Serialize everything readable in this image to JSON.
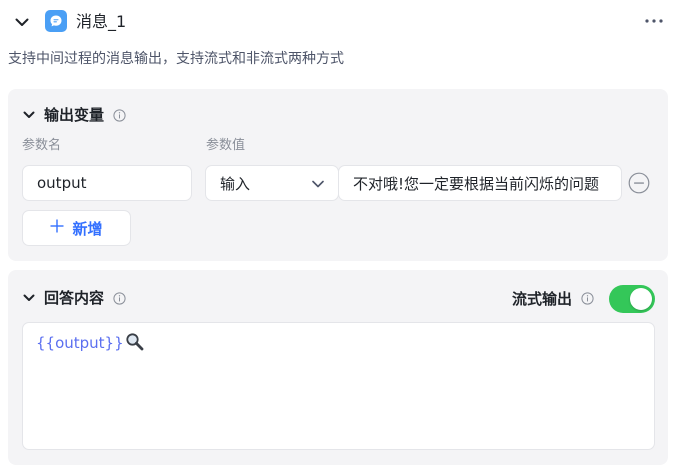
{
  "node": {
    "title": "消息_1",
    "description": "支持中间过程的消息输出，支持流式和非流式两种方式",
    "icon": "chat-bubble-icon",
    "accent_color": "#4a9ff5"
  },
  "outputs_section": {
    "title": "输出变量",
    "name_column_label": "参数名",
    "value_column_label": "参数值",
    "params": [
      {
        "name": "output",
        "type": "输入",
        "value": "不对哦!您一定要根据当前闪烁的问题"
      }
    ],
    "add_label": "新增"
  },
  "answer_section": {
    "title": "回答内容",
    "stream_label": "流式输出",
    "stream_enabled": true,
    "toggle_color": "#34c759",
    "content": "{{output}}"
  }
}
